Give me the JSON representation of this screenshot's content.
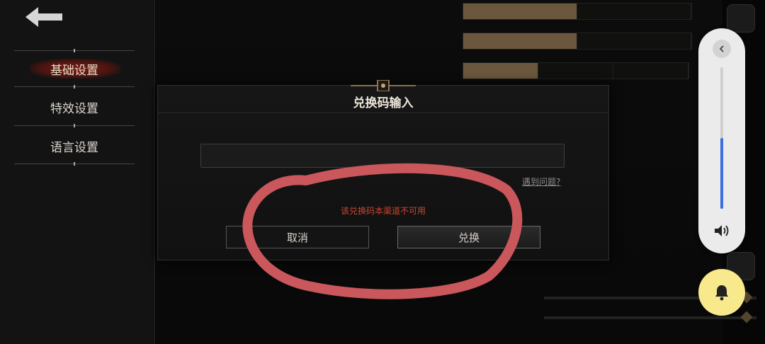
{
  "sidebar": {
    "items": [
      {
        "label": "基础设置",
        "active": true
      },
      {
        "label": "特效设置",
        "active": false
      },
      {
        "label": "语言设置",
        "active": false
      }
    ]
  },
  "dialog": {
    "title": "兑换码输入",
    "input_value": "",
    "input_placeholder": "",
    "help_link": "遇到问题?",
    "error_message": "该兑换码本渠道不可用",
    "cancel_label": "取消",
    "confirm_label": "兑换"
  },
  "volume": {
    "level": 0.5
  },
  "colors": {
    "accent_gold": "#b9976a",
    "error_red": "#c94632",
    "annotation_red": "#c9575c",
    "volume_blue": "#3b6fe0",
    "bell_yellow": "#f7e98c"
  },
  "icons": [
    "back-arrow-icon",
    "collapse-chevron-icon",
    "speaker-icon",
    "bell-icon",
    "diamond-icon",
    "exit-icon"
  ]
}
